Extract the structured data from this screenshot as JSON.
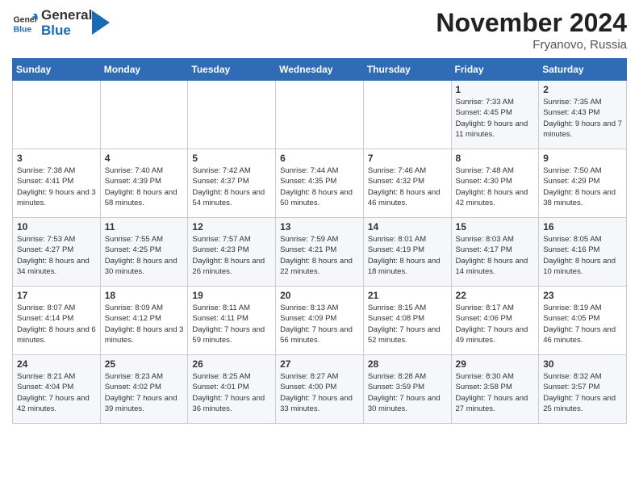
{
  "header": {
    "logo_general": "General",
    "logo_blue": "Blue",
    "month_title": "November 2024",
    "location": "Fryanovo, Russia"
  },
  "days_of_week": [
    "Sunday",
    "Monday",
    "Tuesday",
    "Wednesday",
    "Thursday",
    "Friday",
    "Saturday"
  ],
  "weeks": [
    [
      {
        "day": "",
        "info": ""
      },
      {
        "day": "",
        "info": ""
      },
      {
        "day": "",
        "info": ""
      },
      {
        "day": "",
        "info": ""
      },
      {
        "day": "",
        "info": ""
      },
      {
        "day": "1",
        "info": "Sunrise: 7:33 AM\nSunset: 4:45 PM\nDaylight: 9 hours and 11 minutes."
      },
      {
        "day": "2",
        "info": "Sunrise: 7:35 AM\nSunset: 4:43 PM\nDaylight: 9 hours and 7 minutes."
      }
    ],
    [
      {
        "day": "3",
        "info": "Sunrise: 7:38 AM\nSunset: 4:41 PM\nDaylight: 9 hours and 3 minutes."
      },
      {
        "day": "4",
        "info": "Sunrise: 7:40 AM\nSunset: 4:39 PM\nDaylight: 8 hours and 58 minutes."
      },
      {
        "day": "5",
        "info": "Sunrise: 7:42 AM\nSunset: 4:37 PM\nDaylight: 8 hours and 54 minutes."
      },
      {
        "day": "6",
        "info": "Sunrise: 7:44 AM\nSunset: 4:35 PM\nDaylight: 8 hours and 50 minutes."
      },
      {
        "day": "7",
        "info": "Sunrise: 7:46 AM\nSunset: 4:32 PM\nDaylight: 8 hours and 46 minutes."
      },
      {
        "day": "8",
        "info": "Sunrise: 7:48 AM\nSunset: 4:30 PM\nDaylight: 8 hours and 42 minutes."
      },
      {
        "day": "9",
        "info": "Sunrise: 7:50 AM\nSunset: 4:29 PM\nDaylight: 8 hours and 38 minutes."
      }
    ],
    [
      {
        "day": "10",
        "info": "Sunrise: 7:53 AM\nSunset: 4:27 PM\nDaylight: 8 hours and 34 minutes."
      },
      {
        "day": "11",
        "info": "Sunrise: 7:55 AM\nSunset: 4:25 PM\nDaylight: 8 hours and 30 minutes."
      },
      {
        "day": "12",
        "info": "Sunrise: 7:57 AM\nSunset: 4:23 PM\nDaylight: 8 hours and 26 minutes."
      },
      {
        "day": "13",
        "info": "Sunrise: 7:59 AM\nSunset: 4:21 PM\nDaylight: 8 hours and 22 minutes."
      },
      {
        "day": "14",
        "info": "Sunrise: 8:01 AM\nSunset: 4:19 PM\nDaylight: 8 hours and 18 minutes."
      },
      {
        "day": "15",
        "info": "Sunrise: 8:03 AM\nSunset: 4:17 PM\nDaylight: 8 hours and 14 minutes."
      },
      {
        "day": "16",
        "info": "Sunrise: 8:05 AM\nSunset: 4:16 PM\nDaylight: 8 hours and 10 minutes."
      }
    ],
    [
      {
        "day": "17",
        "info": "Sunrise: 8:07 AM\nSunset: 4:14 PM\nDaylight: 8 hours and 6 minutes."
      },
      {
        "day": "18",
        "info": "Sunrise: 8:09 AM\nSunset: 4:12 PM\nDaylight: 8 hours and 3 minutes."
      },
      {
        "day": "19",
        "info": "Sunrise: 8:11 AM\nSunset: 4:11 PM\nDaylight: 7 hours and 59 minutes."
      },
      {
        "day": "20",
        "info": "Sunrise: 8:13 AM\nSunset: 4:09 PM\nDaylight: 7 hours and 56 minutes."
      },
      {
        "day": "21",
        "info": "Sunrise: 8:15 AM\nSunset: 4:08 PM\nDaylight: 7 hours and 52 minutes."
      },
      {
        "day": "22",
        "info": "Sunrise: 8:17 AM\nSunset: 4:06 PM\nDaylight: 7 hours and 49 minutes."
      },
      {
        "day": "23",
        "info": "Sunrise: 8:19 AM\nSunset: 4:05 PM\nDaylight: 7 hours and 46 minutes."
      }
    ],
    [
      {
        "day": "24",
        "info": "Sunrise: 8:21 AM\nSunset: 4:04 PM\nDaylight: 7 hours and 42 minutes."
      },
      {
        "day": "25",
        "info": "Sunrise: 8:23 AM\nSunset: 4:02 PM\nDaylight: 7 hours and 39 minutes."
      },
      {
        "day": "26",
        "info": "Sunrise: 8:25 AM\nSunset: 4:01 PM\nDaylight: 7 hours and 36 minutes."
      },
      {
        "day": "27",
        "info": "Sunrise: 8:27 AM\nSunset: 4:00 PM\nDaylight: 7 hours and 33 minutes."
      },
      {
        "day": "28",
        "info": "Sunrise: 8:28 AM\nSunset: 3:59 PM\nDaylight: 7 hours and 30 minutes."
      },
      {
        "day": "29",
        "info": "Sunrise: 8:30 AM\nSunset: 3:58 PM\nDaylight: 7 hours and 27 minutes."
      },
      {
        "day": "30",
        "info": "Sunrise: 8:32 AM\nSunset: 3:57 PM\nDaylight: 7 hours and 25 minutes."
      }
    ]
  ]
}
